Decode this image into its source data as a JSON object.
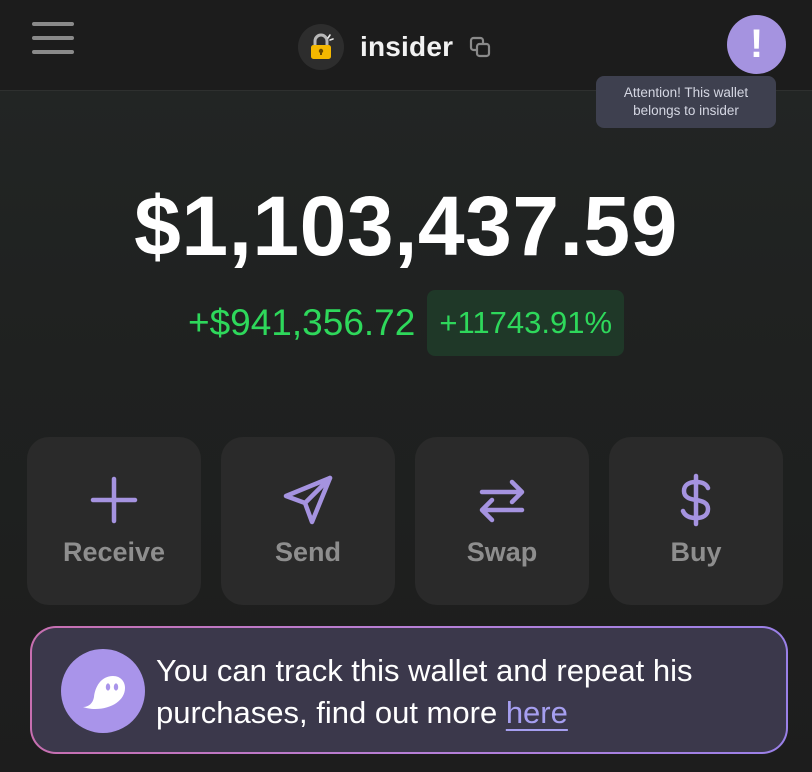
{
  "header": {
    "menu_icon": "hamburger-menu-icon",
    "avatar_icon": "lock-icon",
    "wallet_name": "insider",
    "copy_icon": "copy-icon",
    "alert_symbol": "!",
    "tooltip": "Attention! This wallet belongs to insider"
  },
  "balance": {
    "total": "$1,103,437.59",
    "change_amount": "+$941,356.72",
    "change_percent": "+11743.91%"
  },
  "actions": [
    {
      "label": "Receive",
      "icon": "plus-icon"
    },
    {
      "label": "Send",
      "icon": "send-icon"
    },
    {
      "label": "Swap",
      "icon": "swap-icon"
    },
    {
      "label": "Buy",
      "icon": "dollar-icon"
    }
  ],
  "promo": {
    "logo_icon": "ghost-icon",
    "text": "You can track this wallet and repeat his purchases, find out more",
    "link_text": "here"
  },
  "colors": {
    "accent": "#a593e0",
    "positive": "#2ed85b",
    "positive_bg": "#1f3828",
    "card_bg": "#2a2a2a",
    "promo_bg": "#3b384b"
  }
}
